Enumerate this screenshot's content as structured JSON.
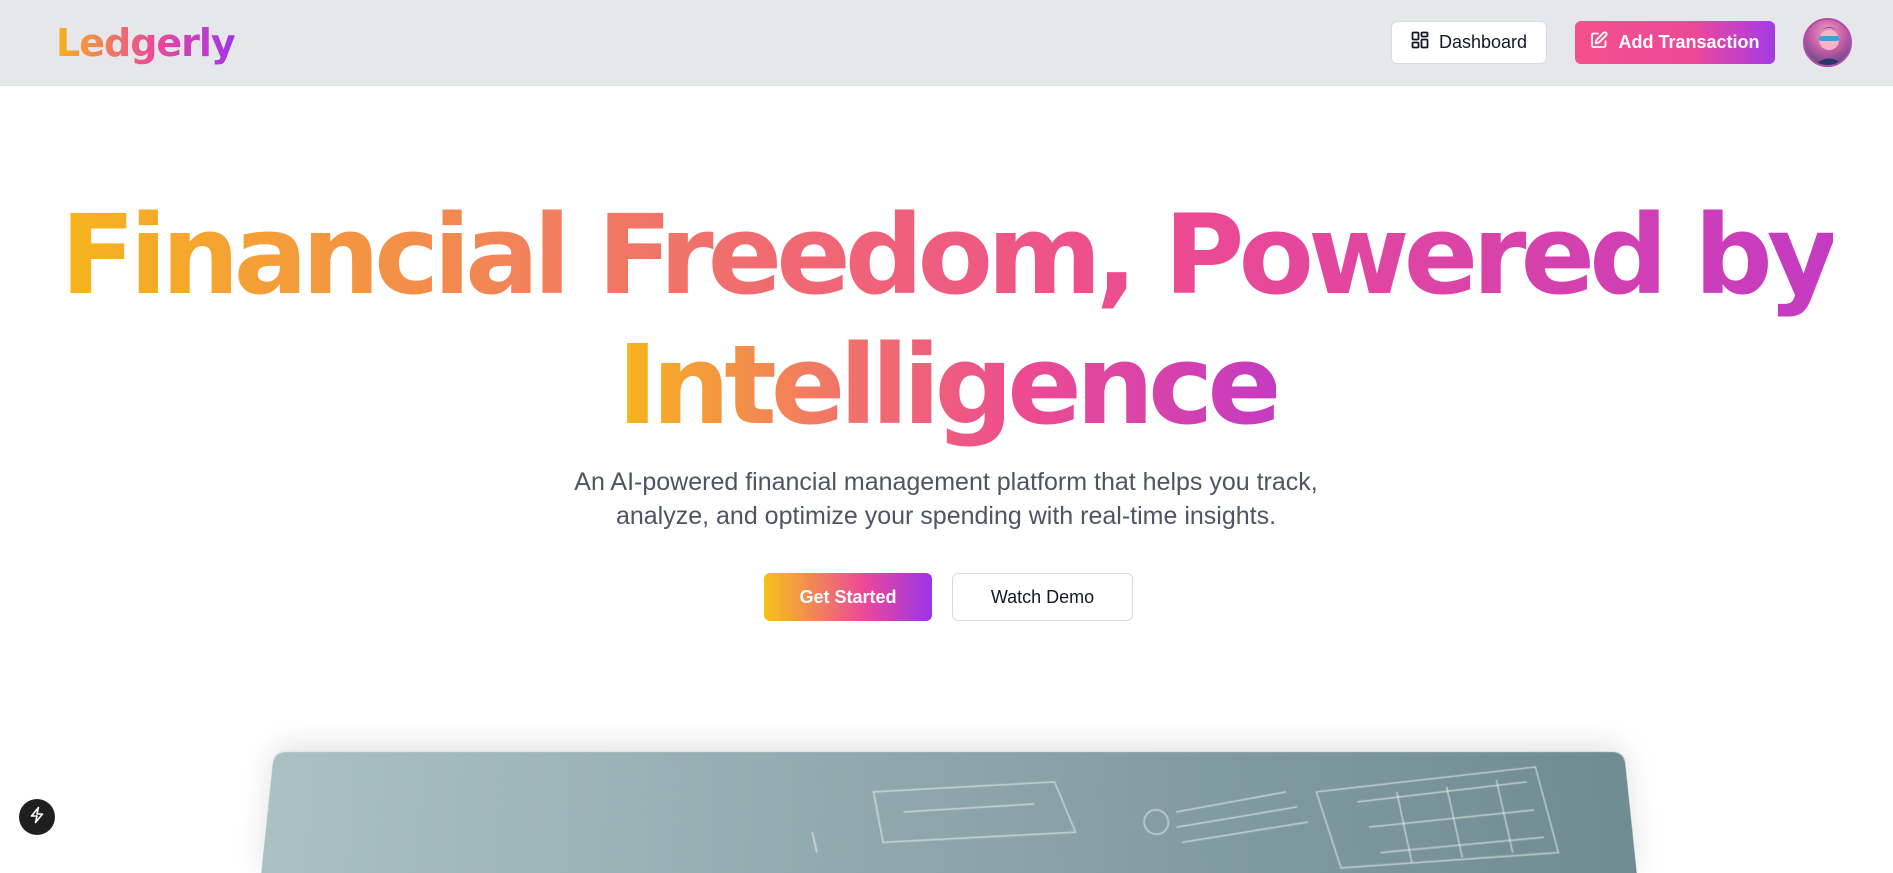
{
  "header": {
    "logo_text": "Ledgerly",
    "dashboard_label": "Dashboard",
    "add_transaction_label": "Add Transaction"
  },
  "hero": {
    "title_line1": "Financial Freedom, Powered by",
    "title_line2": "Intelligence",
    "subtitle_line1": "An AI-powered financial management platform that helps you track,",
    "subtitle_line2": "analyze, and optimize your spending with real-time insights.",
    "get_started_label": "Get Started",
    "watch_demo_label": "Watch Demo"
  },
  "colors": {
    "brand_gradient_start": "#f7b51c",
    "brand_gradient_mid": "#ec4899",
    "brand_gradient_end": "#a335e8",
    "header_bg": "#e5e7eb",
    "subtitle_text": "#4b5563"
  },
  "icons": {
    "dashboard": "grid-icon",
    "add_transaction": "edit-icon",
    "floating": "bolt-icon"
  }
}
